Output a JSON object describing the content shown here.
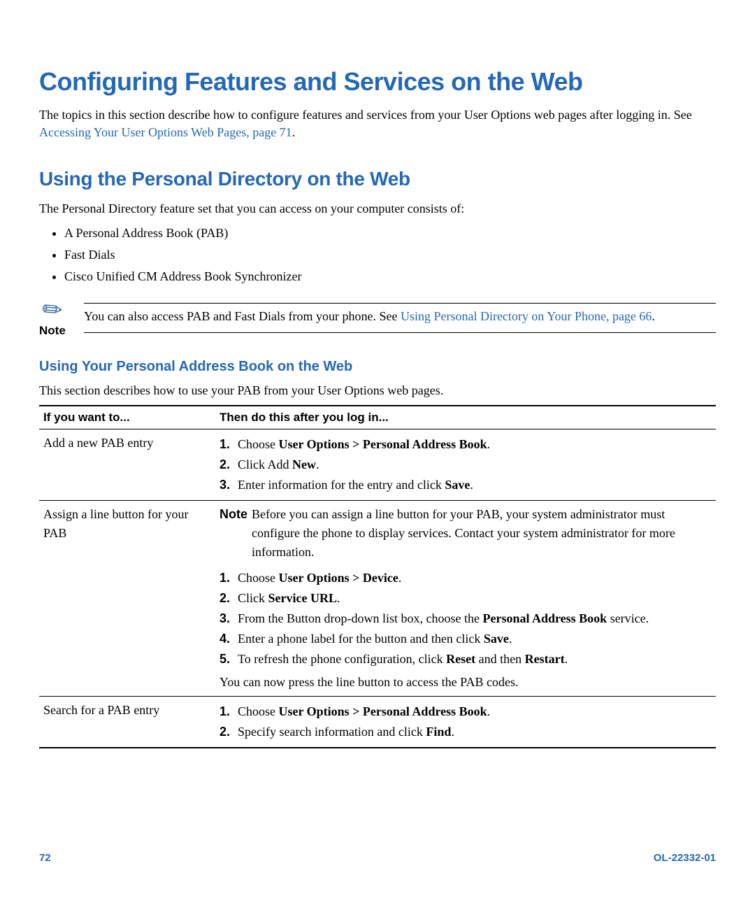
{
  "h1": "Configuring Features and Services on the Web",
  "intro_before_link": "The topics in this section describe how to configure features and services from your User Options web pages after logging in. See ",
  "intro_link": "Accessing Your User Options Web Pages, page 71",
  "intro_after_link": ".",
  "h2": "Using the Personal Directory on the Web",
  "pd_intro": "The Personal Directory feature set that you can access on your computer consists of:",
  "pd_bullets": [
    "A Personal Address Book (PAB)",
    "Fast Dials",
    "Cisco Unified CM Address Book Synchronizer"
  ],
  "note_label": "Note",
  "note_text_before_link": "You can also access PAB and Fast Dials from your phone. See ",
  "note_link": "Using Personal Directory on Your Phone, page 66",
  "note_text_after_link": ".",
  "h3": "Using Your Personal Address Book on the Web",
  "h3_intro": "This section describes how to use your PAB from your User Options web pages.",
  "table": {
    "col1_header": "If you want to...",
    "col2_header": "Then do this after you log in...",
    "rows": [
      {
        "col1": "Add a new PAB entry",
        "steps": [
          {
            "num": "1.",
            "pre": "Choose ",
            "bold": "User Options > Personal Address Book",
            "post": "."
          },
          {
            "num": "2.",
            "pre": "Click Add ",
            "bold": "New",
            "post": "."
          },
          {
            "num": "3.",
            "pre": "Enter information for the entry and click ",
            "bold": "Save",
            "post": "."
          }
        ]
      },
      {
        "col1": "Assign a line button for your PAB",
        "note_label": "Note",
        "note_text": "Before you can assign a line button for your PAB, your system administrator must configure the phone to display services. Contact your system administrator for more information.",
        "steps": [
          {
            "num": "1.",
            "pre": "Choose ",
            "bold": "User Options > Device",
            "post": "."
          },
          {
            "num": "2.",
            "pre": "Click ",
            "bold": "Service URL",
            "post": "."
          },
          {
            "num": "3.",
            "pre": "From the Button drop-down list box, choose the ",
            "bold": "Personal Address Book",
            "post": " service."
          },
          {
            "num": "4.",
            "pre": "Enter a phone label for the button and then click ",
            "bold": "Save",
            "post": "."
          },
          {
            "num": "5.",
            "pre": "To refresh the phone configuration, click ",
            "bold": "Reset",
            "post": " and then ",
            "bold2": "Restart",
            "post2": "."
          }
        ],
        "closing": "You can now press the line button to access the PAB codes."
      },
      {
        "col1": "Search for a PAB entry",
        "steps": [
          {
            "num": "1.",
            "pre": "Choose ",
            "bold": "User Options > Personal Address Book",
            "post": "."
          },
          {
            "num": "2.",
            "pre": "Specify search information and click ",
            "bold": "Find",
            "post": "."
          }
        ]
      }
    ]
  },
  "footer": {
    "page": "72",
    "docid": "OL-22332-01"
  }
}
